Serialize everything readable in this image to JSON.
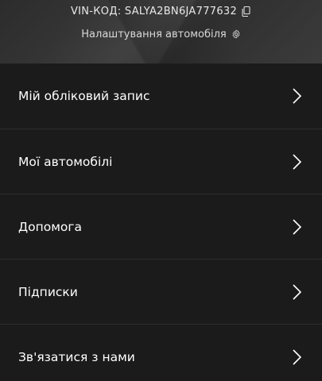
{
  "header": {
    "vin_text": "VIN-КОД: SALYA2BN6JA777632",
    "vehicle_settings": "Налаштування автомобіля"
  },
  "menu": {
    "items": [
      {
        "label": "Мій обліковий запис"
      },
      {
        "label": "Мої автомобілі"
      },
      {
        "label": "Допомога"
      },
      {
        "label": "Підписки"
      },
      {
        "label": "Зв'язатися з нами"
      }
    ]
  },
  "colors": {
    "background": "#1b1b1b",
    "divider": "#2e2e2e",
    "text": "#ffffff"
  },
  "icons": {
    "copy": "copy-icon",
    "settings": "gear-icon",
    "chevron": "chevron-right-icon"
  }
}
